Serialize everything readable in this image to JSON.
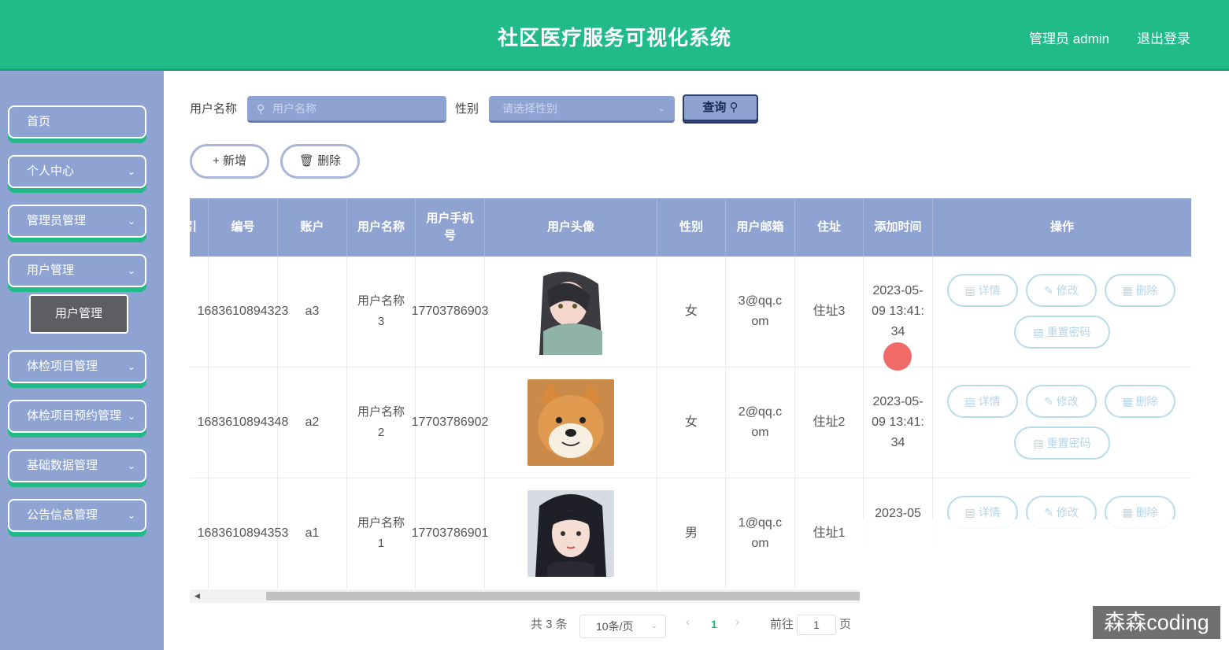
{
  "header": {
    "title": "社区医疗服务可视化系统",
    "user_label": "管理员 admin",
    "logout_label": "退出登录"
  },
  "sidebar": {
    "items": [
      {
        "label": "首页",
        "has_arrow": false
      },
      {
        "label": "个人中心",
        "has_arrow": true
      },
      {
        "label": "管理员管理",
        "has_arrow": true
      },
      {
        "label": "用户管理",
        "has_arrow": true
      },
      {
        "label": "体检项目管理",
        "has_arrow": true
      },
      {
        "label": "体检项目预约管理",
        "has_arrow": true
      },
      {
        "label": "基础数据管理",
        "has_arrow": true
      },
      {
        "label": "公告信息管理",
        "has_arrow": true
      }
    ],
    "active_submenu": "用户管理"
  },
  "search": {
    "name_label": "用户名称",
    "name_placeholder": "用户名称",
    "gender_label": "性别",
    "gender_placeholder": "请选择性别",
    "query_label": "查询"
  },
  "actions": {
    "add_label": "新增",
    "delete_label": "删除"
  },
  "table": {
    "columns": [
      "引",
      "编号",
      "账户",
      "用户名称",
      "用户手机号",
      "用户头像",
      "性别",
      "用户邮箱",
      "住址",
      "添加时间",
      "操作"
    ],
    "rows": [
      {
        "id": "1683610894323",
        "account": "a3",
        "name": "用户名称3",
        "phone": "17703786903",
        "avatar": "anime-girl-avatar",
        "gender": "女",
        "email": "3@qq.com",
        "address": "住址3",
        "time": "2023-05-09 13:41:34"
      },
      {
        "id": "1683610894348",
        "account": "a2",
        "name": "用户名称2",
        "phone": "17703786902",
        "avatar": "shiba-dog-avatar",
        "gender": "女",
        "email": "2@qq.com",
        "address": "住址2",
        "time": "2023-05-09 13:41:34"
      },
      {
        "id": "1683610894353",
        "account": "a1",
        "name": "用户名称1",
        "phone": "17703786901",
        "avatar": "girl-photo-avatar",
        "gender": "男",
        "email": "1@qq.com",
        "address": "住址1",
        "time": "2023-05"
      }
    ],
    "row_actions": {
      "detail": "详情",
      "edit": "修改",
      "delete": "删除",
      "reset": "重置密码"
    }
  },
  "pagination": {
    "total_text": "共 3 条",
    "page_size": "10条/页",
    "current_page": "1",
    "goto_label": "前往",
    "goto_value": "1",
    "page_suffix": "页"
  },
  "watermark": "森森coding",
  "colors": {
    "header": "#20bb89",
    "sidebar": "#8fa3d3",
    "accent": "#20bb89"
  }
}
